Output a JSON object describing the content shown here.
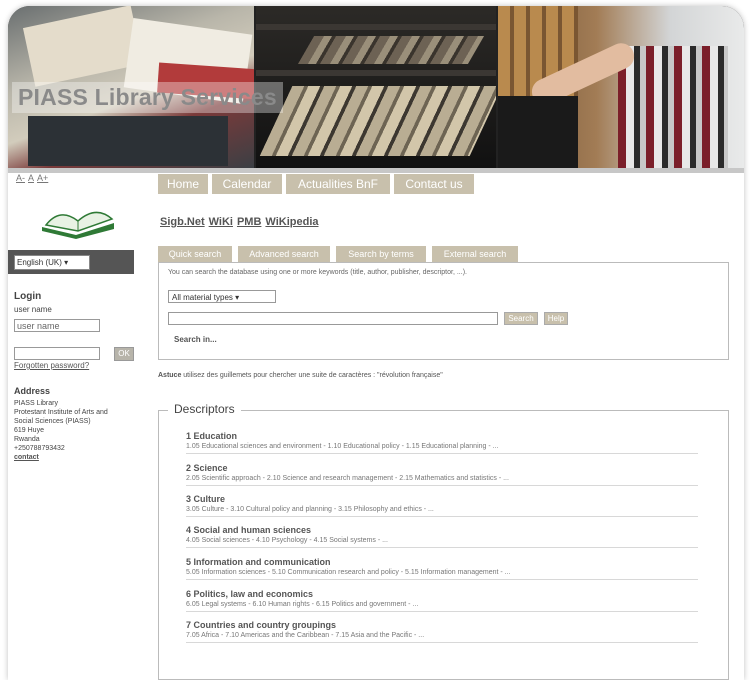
{
  "site_title": "PIASS Library Services",
  "font_size_controls": [
    "A-",
    "A",
    "A+"
  ],
  "language": {
    "selected": "English (UK)"
  },
  "login": {
    "heading": "Login",
    "user_label": "user name",
    "user_placeholder": "user name",
    "ok_label": "OK",
    "forgot_link": "Forgotten password?"
  },
  "address": {
    "heading": "Address",
    "lines": [
      "PIASS Library",
      "Protestant Institute of Arts and",
      "Social Sciences (PIASS)",
      "619 Huye",
      "Rwanda",
      "+250788793432"
    ],
    "contact_link": "contact"
  },
  "nav": [
    "Home",
    "Calendar",
    "Actualities BnF",
    "Contact us"
  ],
  "top_links": [
    "Sigb.Net",
    "WiKi",
    "PMB",
    "WiKipedia"
  ],
  "search": {
    "tabs": [
      "Quick search",
      "Advanced search",
      "Search by terms",
      "External search"
    ],
    "help_text": "You can search the database using one or more keywords (title, author, publisher, descriptor, ...).",
    "material_select": "All material types",
    "search_button": "Search",
    "help_button": "Help",
    "search_in": "Search in..."
  },
  "tip": {
    "label": "Astuce",
    "text": " utilisez des guillemets pour chercher une suite de caractères : \"révolution française\""
  },
  "descriptors": {
    "heading": "Descriptors",
    "categories": [
      {
        "title": "1 Education",
        "sub": "1.05 Educational sciences and environment - 1.10 Educational policy - 1.15 Educational planning - ..."
      },
      {
        "title": "2 Science",
        "sub": "2.05 Scientific approach - 2.10 Science and research management - 2.15 Mathematics and statistics - ..."
      },
      {
        "title": "3 Culture",
        "sub": "3.05 Culture - 3.10 Cultural policy and planning - 3.15 Philosophy and ethics - ..."
      },
      {
        "title": "4 Social and human sciences",
        "sub": "4.05 Social sciences - 4.10 Psychology - 4.15 Social systems - ..."
      },
      {
        "title": "5 Information and communication",
        "sub": "5.05 Information sciences - 5.10 Communication research and policy - 5.15 Information management - ..."
      },
      {
        "title": "6 Politics, law and economics",
        "sub": "6.05 Legal systems - 6.10 Human rights - 6.15 Politics and government - ..."
      },
      {
        "title": "7 Countries and country groupings",
        "sub": "7.05 Africa - 7.10 Americas and the Caribbean - 7.15 Asia and the Pacific - ..."
      }
    ]
  }
}
